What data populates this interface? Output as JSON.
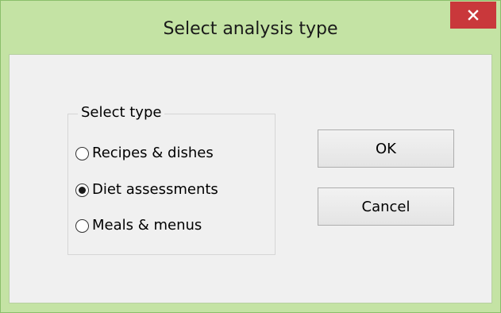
{
  "window": {
    "title": "Select analysis type",
    "close_icon": "close-icon",
    "accent_color": "#c4e3a4",
    "close_color": "#c9383b"
  },
  "group": {
    "label": "Select type",
    "options": [
      {
        "label": "Recipes & dishes",
        "checked": false
      },
      {
        "label": "Diet assessments",
        "checked": true
      },
      {
        "label": "Meals & menus",
        "checked": false
      }
    ]
  },
  "buttons": {
    "ok_label": "OK",
    "cancel_label": "Cancel"
  }
}
